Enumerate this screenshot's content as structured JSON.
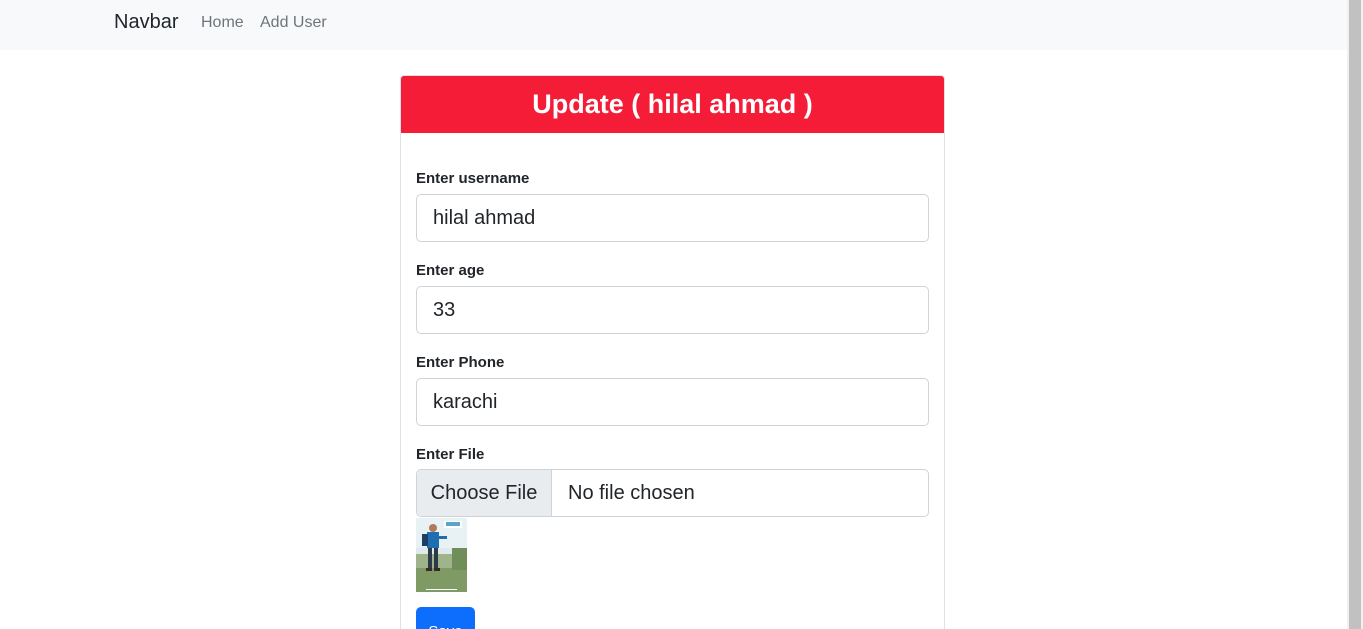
{
  "navbar": {
    "brand": "Navbar",
    "links": [
      {
        "label": "Home"
      },
      {
        "label": "Add User"
      }
    ]
  },
  "card": {
    "title": "Update ( hilal ahmad )"
  },
  "form": {
    "username": {
      "label": "Enter username",
      "value": "hilal ahmad"
    },
    "age": {
      "label": "Enter age",
      "value": "33"
    },
    "phone": {
      "label": "Enter Phone",
      "value": "karachi"
    },
    "file": {
      "label": "Enter File",
      "button_label": "Choose File",
      "status": "No file chosen"
    },
    "save_label": "Save"
  },
  "colors": {
    "header": "#f41c37",
    "primary": "#0d6efd",
    "navbar_bg": "#f8f9fa"
  }
}
